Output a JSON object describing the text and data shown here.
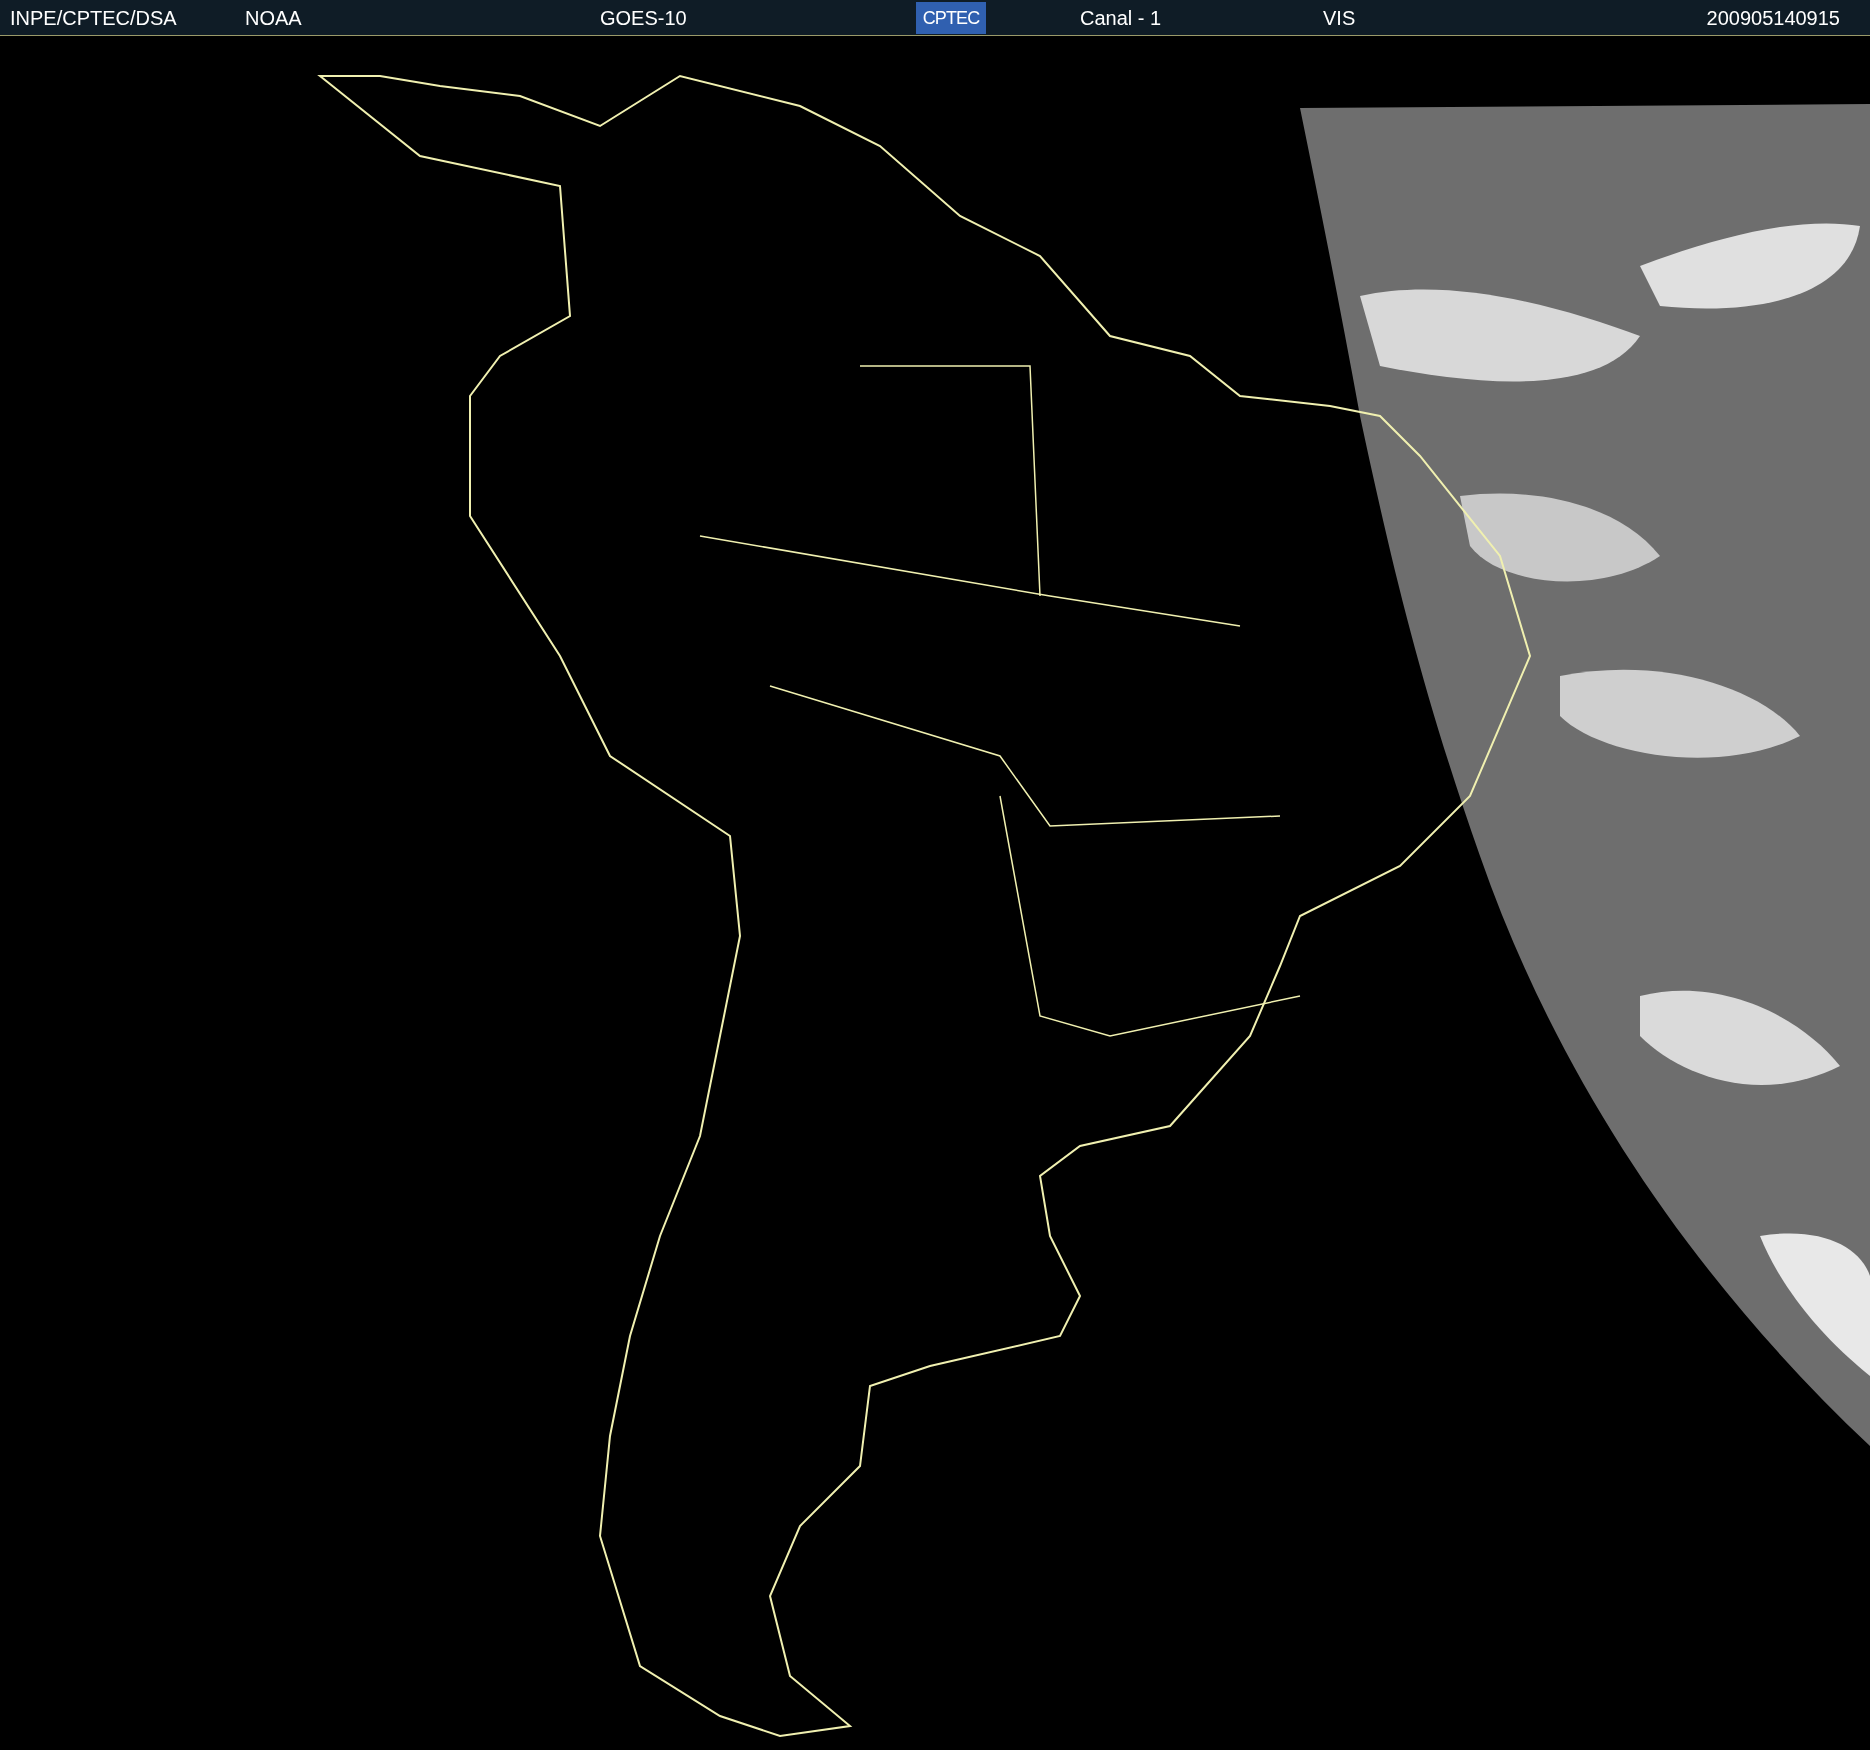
{
  "header": {
    "source": "INPE/CPTEC/DSA",
    "agency": "NOAA",
    "satellite": "GOES-10",
    "logo": "CPTEC",
    "channel": "Canal - 1",
    "band": "VIS",
    "timestamp": "200905140915"
  }
}
